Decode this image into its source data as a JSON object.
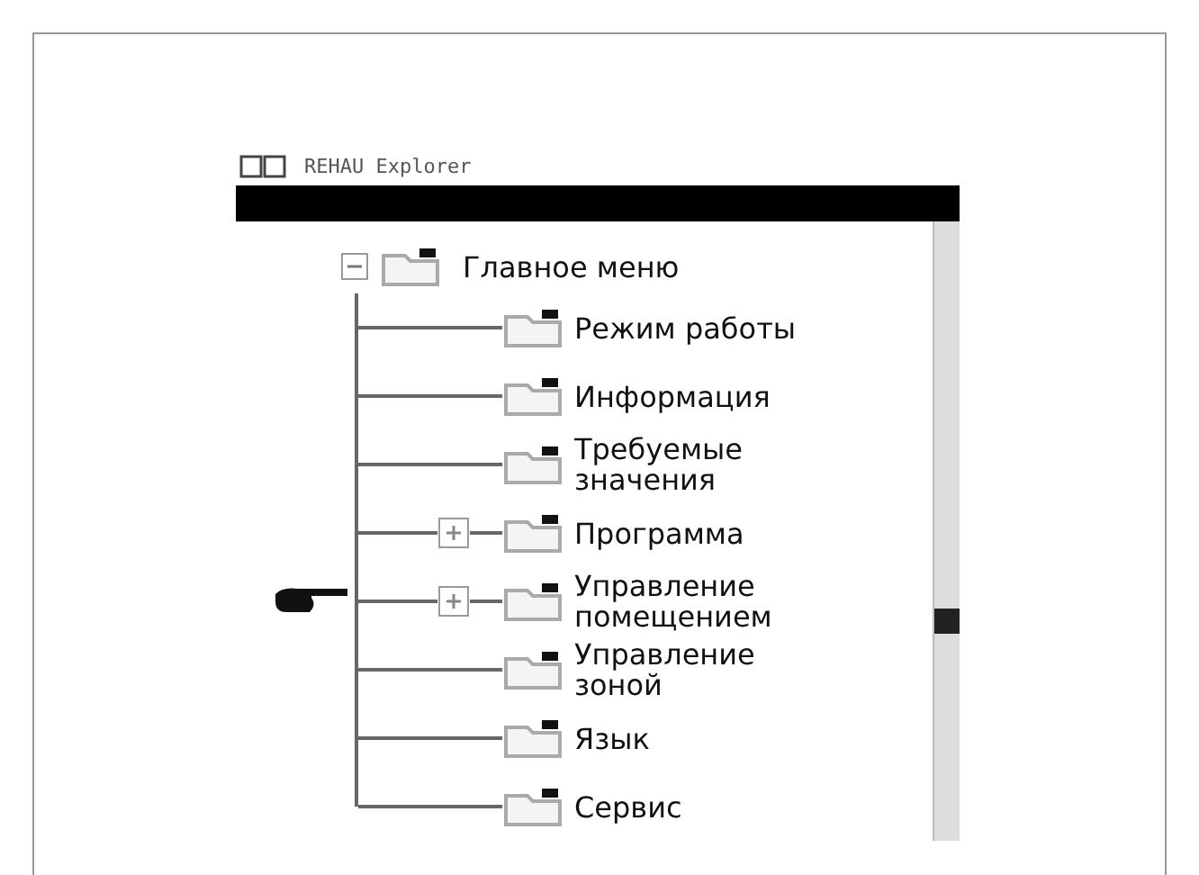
{
  "window": {
    "title": "REHAU Explorer"
  },
  "tree": {
    "label": "Главное меню",
    "expanded": true,
    "children": [
      {
        "label": "Режим работы",
        "kind": "leaf",
        "pointed": false
      },
      {
        "label": "Информация",
        "kind": "leaf",
        "pointed": false
      },
      {
        "label": "Требуемые значения",
        "kind": "leaf",
        "pointed": false
      },
      {
        "label": "Программа",
        "kind": "collapsed",
        "pointed": false
      },
      {
        "label": "Управление помещением",
        "kind": "collapsed",
        "pointed": true
      },
      {
        "label": "Управление зоной",
        "kind": "leaf",
        "pointed": false
      },
      {
        "label": "Язык",
        "kind": "leaf",
        "pointed": false
      },
      {
        "label": "Сервис",
        "kind": "leaf",
        "pointed": false
      }
    ]
  }
}
